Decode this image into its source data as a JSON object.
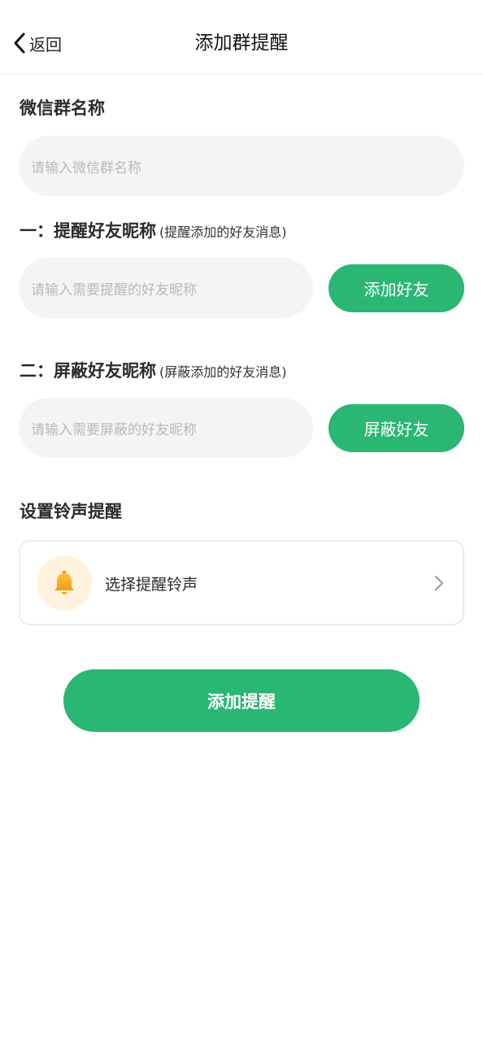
{
  "header": {
    "back_label": "返回",
    "title": "添加群提醒"
  },
  "group_name": {
    "label": "微信群名称",
    "placeholder": "请输入微信群名称"
  },
  "remind_friends": {
    "label": "一：提醒好友昵称",
    "note": "(提醒添加的好友消息)",
    "placeholder": "请输入需要提醒的好友昵称",
    "button_label": "添加好友"
  },
  "block_friends": {
    "label": "二：屏蔽好友昵称",
    "note": "(屏蔽添加的好友消息)",
    "placeholder": "请输入需要屏蔽的好友昵称",
    "button_label": "屏蔽好友"
  },
  "ringtone": {
    "label": "设置铃声提醒",
    "select_label": "选择提醒铃声",
    "icon": "bell-icon"
  },
  "submit_label": "添加提醒",
  "colors": {
    "accent": "#2ab673",
    "input_bg": "#f4f4f4",
    "bell": "#f7a51d",
    "bell_bg": "#fff3df"
  }
}
